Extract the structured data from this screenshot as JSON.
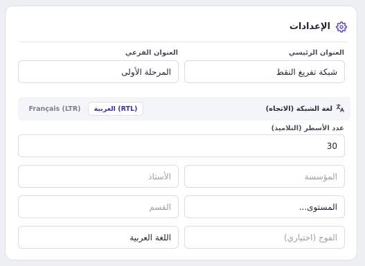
{
  "settings": {
    "title": "الإعدادات",
    "main_title_label": "العنوان الرئيسي",
    "main_title_value": "شبكة تفريغ النقط",
    "subtitle_label": "العنوان الفرعي",
    "subtitle_value": "المرحلة الأولى",
    "grid_language_label": "لغة الشبكة (الاتجاه)",
    "lang_arabic": "العربية (RTL)",
    "lang_french": "Français (LTR)",
    "rows_label": "عدد الأسطر (التلاميذ)",
    "rows_value": "30",
    "institution_placeholder": "المؤسسة",
    "teacher_placeholder": "الأستاذ",
    "level_value": "المستوى...",
    "department_placeholder": "القسم",
    "group_placeholder": "الفوج (اختياري)",
    "subject_value": "اللغة العربية"
  },
  "colors": {
    "accent": "#3d2fa8",
    "gear_icon": "#4b3bc2"
  },
  "icons": {
    "header": "gear-icon",
    "language": "translate-icon"
  }
}
